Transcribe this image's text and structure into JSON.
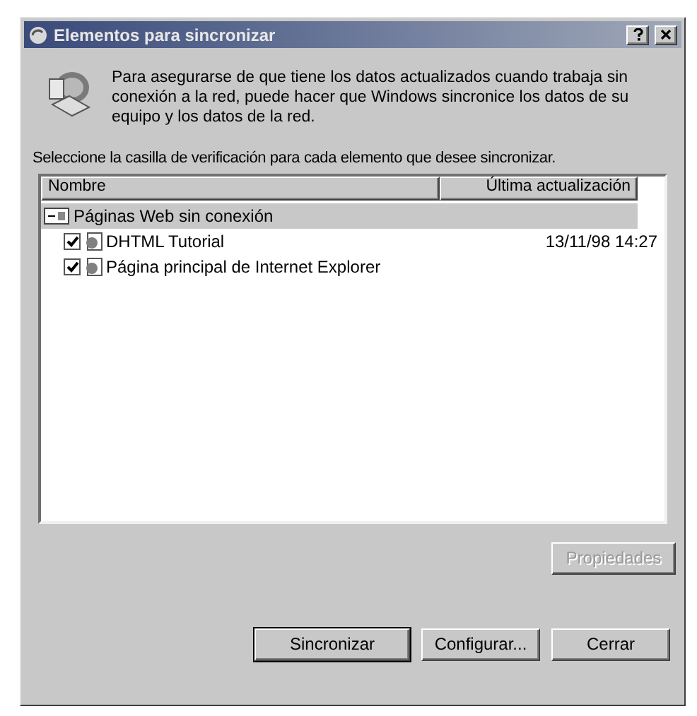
{
  "window": {
    "title": "Elementos para sincronizar"
  },
  "intro": "Para asegurarse de que tiene los datos actualizados cuando trabaja sin conexión a la red, puede hacer que Windows sincronice los datos de su equipo y los datos de la red.",
  "instruction": "Seleccione la casilla de verificación para cada elemento que desee sincronizar.",
  "list": {
    "columns": [
      "Nombre",
      "Última actualización"
    ],
    "groups": [
      {
        "name": "Páginas Web sin conexión",
        "expanded": true,
        "selected": true,
        "children": [
          {
            "name": "DHTML Tutorial",
            "updated": "13/11/98 14:27",
            "checked": true
          },
          {
            "name": "Página principal de Internet Explorer",
            "checked": true
          }
        ]
      }
    ]
  },
  "properties_button": {
    "label": "Propiedades",
    "disabled": true
  },
  "buttons": [
    {
      "label": "Sincronizar",
      "default": true
    },
    {
      "label": "Configurar...",
      "default": false
    },
    {
      "label": "Cerrar",
      "default": false
    }
  ]
}
